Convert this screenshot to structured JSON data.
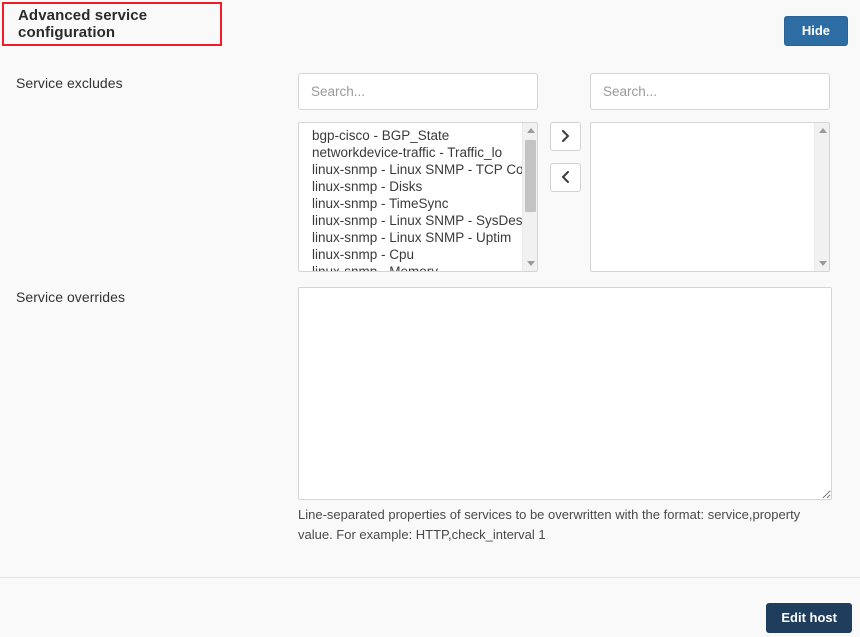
{
  "header": {
    "title": "Advanced service configuration",
    "hide_label": "Hide",
    "highlight_color": "#ee1c25",
    "hide_button_color": "#2e6da4"
  },
  "service_excludes": {
    "label": "Service excludes",
    "search_left_placeholder": "Search...",
    "search_left_value": "",
    "search_right_placeholder": "Search...",
    "search_right_value": "",
    "move_right_icon": "chevron-right-icon",
    "move_left_icon": "chevron-left-icon",
    "available": [
      "bgp-cisco - BGP_State",
      "networkdevice-traffic - Traffic_lo",
      "linux-snmp - Linux SNMP - TCP Co",
      "linux-snmp - Disks",
      "linux-snmp - TimeSync",
      "linux-snmp - Linux SNMP - SysDes",
      "linux-snmp - Linux SNMP - Uptim",
      "linux-snmp - Cpu",
      "linux-snmp - Memory"
    ],
    "selected": []
  },
  "service_overrides": {
    "label": "Service overrides",
    "value": "",
    "help": "Line-separated properties of services to be overwritten with the format: service,property value. For example: HTTP,check_interval 1"
  },
  "footer": {
    "edit_host_label": "Edit host",
    "edit_host_color": "#1f3d5c"
  }
}
